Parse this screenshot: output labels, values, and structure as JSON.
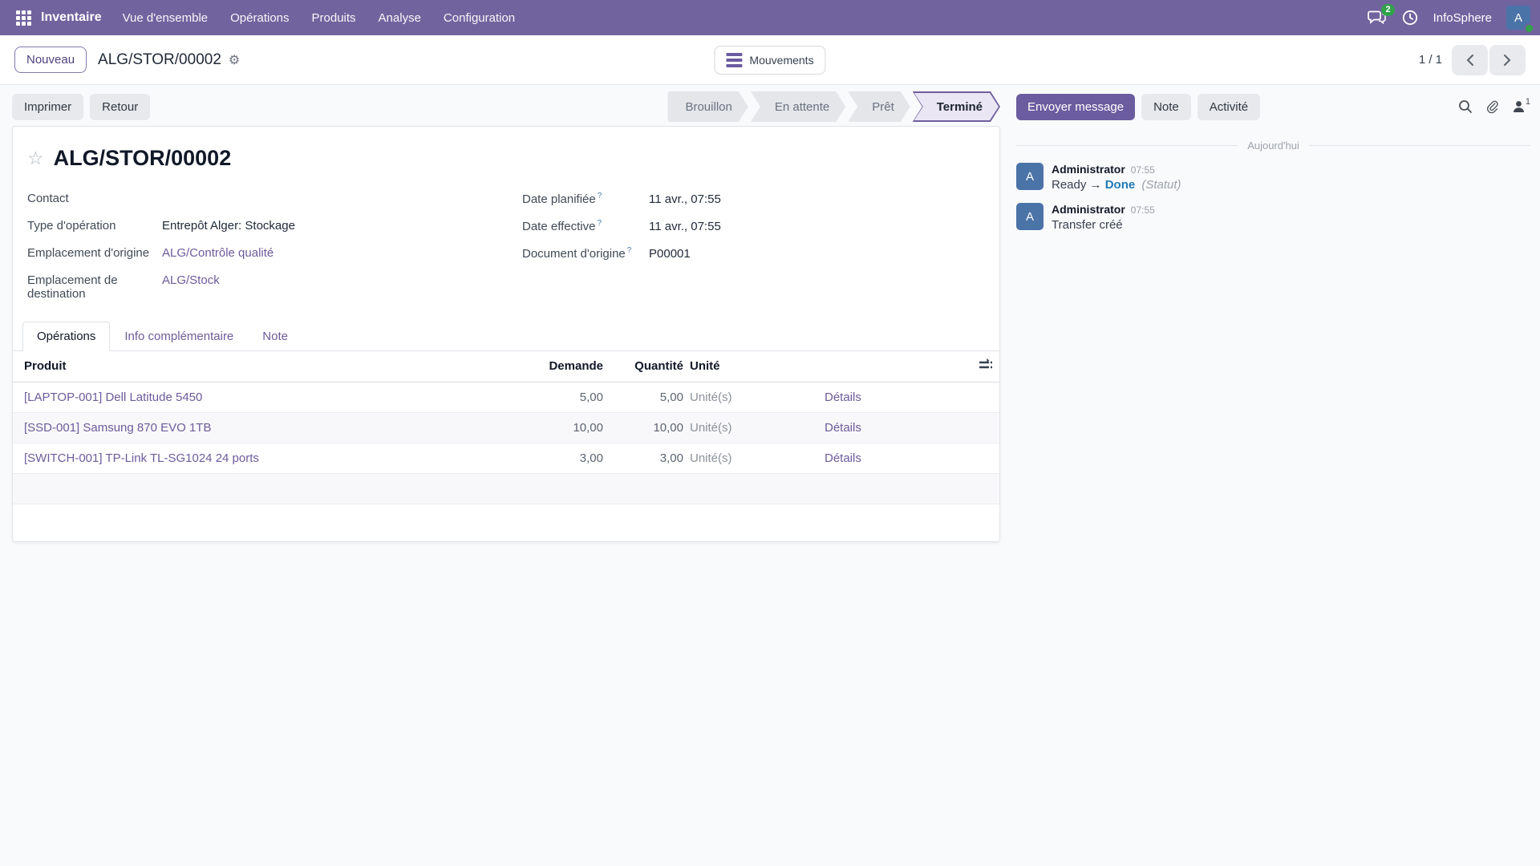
{
  "navbar": {
    "app": "Inventaire",
    "menus": [
      "Vue d'ensemble",
      "Opérations",
      "Produits",
      "Analyse",
      "Configuration"
    ],
    "messages_badge": "2",
    "company": "InfoSphere",
    "avatar_initial": "A"
  },
  "control_panel": {
    "new_button": "Nouveau",
    "breadcrumb_title": "ALG/STOR/00002",
    "movements_button": "Mouvements",
    "pager": "1 / 1"
  },
  "status_bar": {
    "print_button": "Imprimer",
    "return_button": "Retour",
    "steps": [
      "Brouillon",
      "En attente",
      "Prêt",
      "Terminé"
    ],
    "active_step": "Terminé"
  },
  "chatter": {
    "send_message_button": "Envoyer message",
    "note_button": "Note",
    "activity_button": "Activité",
    "follower_count": "1",
    "date_divider": "Aujourd'hui",
    "messages": [
      {
        "author": "Administrator",
        "time": "07:55",
        "from": "Ready",
        "arrow": "→",
        "to": "Done",
        "field": "(Statut)"
      },
      {
        "author": "Administrator",
        "time": "07:55",
        "body": "Transfer créé"
      }
    ]
  },
  "form": {
    "title": "ALG/STOR/00002",
    "help_marker": "?",
    "fields_left": [
      {
        "label": "Contact",
        "value": ""
      },
      {
        "label": "Type d'opération",
        "value": "Entrepôt Alger: Stockage"
      },
      {
        "label": "Emplacement d'origine",
        "value": "ALG/Contrôle qualité"
      },
      {
        "label": "Emplacement de destination",
        "value": "ALG/Stock"
      }
    ],
    "fields_right": [
      {
        "label": "Date planifiée",
        "value": "11 avr., 07:55"
      },
      {
        "label": "Date effective",
        "value": "11 avr., 07:55"
      },
      {
        "label": "Document d'origine",
        "value": "P00001"
      }
    ],
    "tabs": [
      "Opérations",
      "Info complémentaire",
      "Note"
    ],
    "table": {
      "headers": {
        "product": "Produit",
        "demand": "Demande",
        "qty": "Quantité",
        "unit": "Unité"
      },
      "rows": [
        {
          "product": "[LAPTOP-001] Dell Latitude 5450",
          "demand": "5,00",
          "qty": "5,00",
          "unit": "Unité(s)",
          "details": "Détails"
        },
        {
          "product": "[SSD-001] Samsung 870 EVO 1TB",
          "demand": "10,00",
          "qty": "10,00",
          "unit": "Unité(s)",
          "details": "Détails"
        },
        {
          "product": "[SWITCH-001] TP-Link TL-SG1024 24 ports",
          "demand": "3,00",
          "qty": "3,00",
          "unit": "Unité(s)",
          "details": "Détails"
        }
      ]
    }
  },
  "colors": {
    "navbar_bg": "#71639e",
    "primary_button": "#6b5c9f",
    "link": "#6d5b9b",
    "active_step_bg": "#eae6f4",
    "active_step_border": "#6f5f9e",
    "tracking_done_blue": "#2179b8",
    "avatar_blue": "#4a73a8",
    "badge_green": "#31a24c",
    "page_bg": "#f9fafb"
  }
}
